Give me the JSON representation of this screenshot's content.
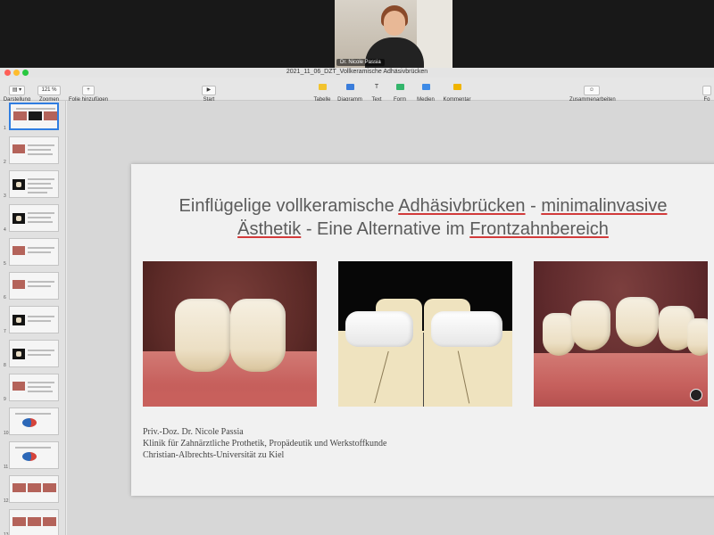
{
  "video": {
    "participant_name": "Dr. Nicole Passia"
  },
  "window": {
    "document_title": "2021_11_06_DZT_Vollkeramische Adhäsivbrücken"
  },
  "toolbar": {
    "view_label": "Darstellung",
    "zoom_value": "121 %",
    "zoom_label": "Zoomen",
    "add_slide_label": "Folie hinzufügen",
    "play_label": "Start",
    "table_label": "Tabelle",
    "chart_label": "Diagramm",
    "text_label": "Text",
    "shape_label": "Form",
    "media_label": "Medien",
    "comment_label": "Kommentar",
    "collaborate_label": "Zusammenarbeiten",
    "format_label": "Fo"
  },
  "sidebar": {
    "slides": [
      "1",
      "2",
      "3",
      "4",
      "5",
      "6",
      "7",
      "8",
      "9",
      "10",
      "11",
      "12",
      "13"
    ]
  },
  "slide": {
    "title_part1": "Einflügelige vollkeramische ",
    "title_u1": "Adhäsivbrücken",
    "title_part2": " - ",
    "title_u2": "minimalinvasive",
    "title_u3": "Ästhetik",
    "title_part3": " - Eine Alternative im ",
    "title_u4": "Frontzahnbereich",
    "author": "Priv.-Doz. Dr. Nicole Passia",
    "affiliation": "Klinik für Zahnärztliche Prothetik, Propädeutik und  Werkstoffkunde",
    "university": "Christian-Albrechts-Universität zu Kiel"
  },
  "colors": {
    "selection": "#2f7de1",
    "underline": "#d23a3a"
  }
}
